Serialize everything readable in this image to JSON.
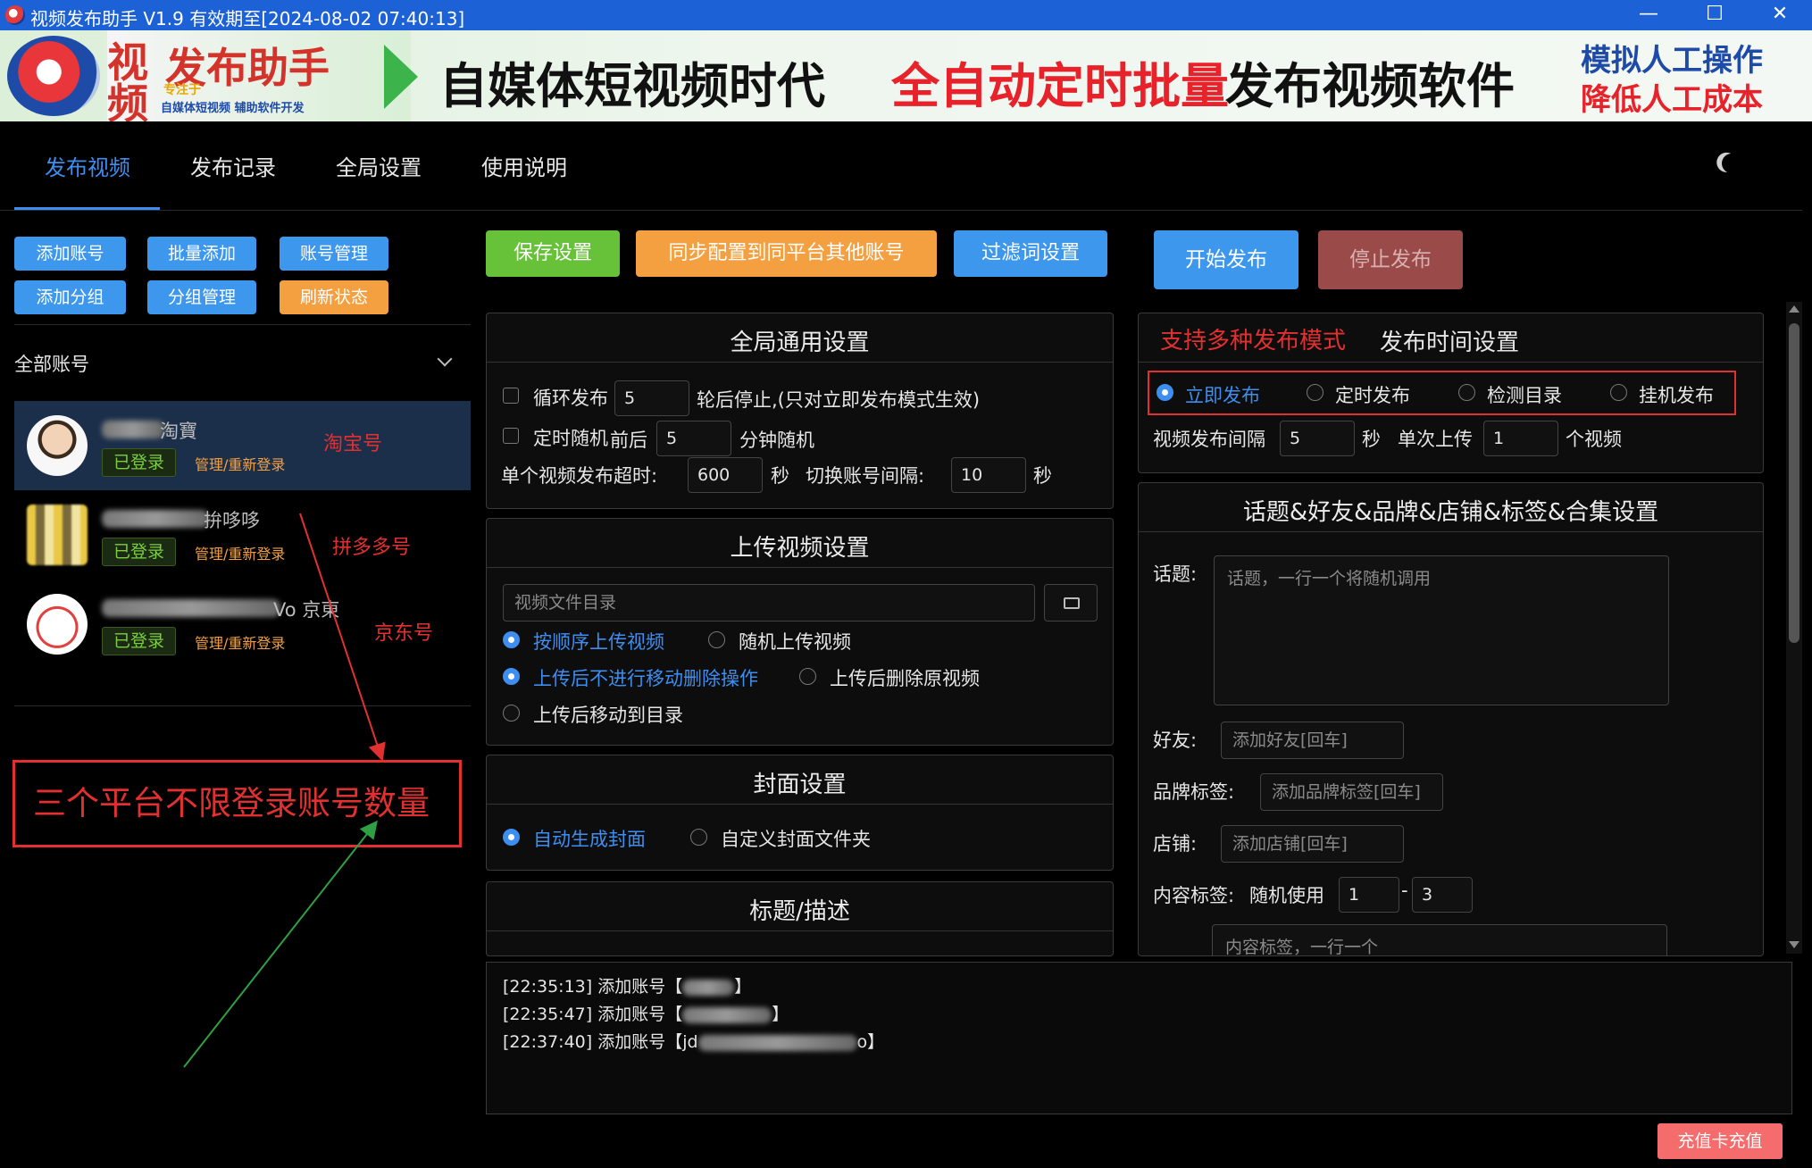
{
  "window": {
    "title": "视频发布助手 V1.9 有效期至[2024-08-02 07:40:13]",
    "minimize": "—",
    "maximize": "☐",
    "close": "✕"
  },
  "banner": {
    "logo_char_1": "视",
    "logo_char_2": "频",
    "logo_title": "发布助手",
    "logo_tag": "专注于",
    "logo_sub": "自媒体短视频 辅助软件开发",
    "slogan_black": "自媒体短视频时代",
    "slogan_red": "全自动定时批量",
    "slogan_black2": "发布视频软件",
    "right_line1": "模拟人工操作",
    "right_line2": "降低人工成本"
  },
  "tabs": [
    {
      "label": "发布视频",
      "active": true
    },
    {
      "label": "发布记录",
      "active": false
    },
    {
      "label": "全局设置",
      "active": false
    },
    {
      "label": "使用说明",
      "active": false
    }
  ],
  "left": {
    "buttons_row1": [
      "添加账号",
      "批量添加",
      "账号管理"
    ],
    "buttons_row2": [
      "添加分组",
      "分组管理",
      "刷新状态"
    ],
    "group_label": "全部账号",
    "accounts": [
      {
        "name_suffix": "淘寶",
        "status": "已登录",
        "relogin": "管理/重新登录",
        "note": "淘宝号"
      },
      {
        "name_suffix": "拚哆哆",
        "status": "已登录",
        "relogin": "管理/重新登录",
        "note": "拼多多号"
      },
      {
        "name_suffix": "Vo 京東",
        "status": "已登录",
        "relogin": "管理/重新登录",
        "note": "京东号"
      }
    ],
    "annotation": "三个平台不限登录账号数量"
  },
  "toolbar": {
    "save": "保存设置",
    "sync": "同步配置到同平台其他账号",
    "filter": "过滤词设置",
    "start": "开始发布",
    "stop": "停止发布"
  },
  "global_settings": {
    "title": "全局通用设置",
    "loop_label": "循环发布",
    "loop_value": "5",
    "loop_suffix": "轮后停止,(只对立即发布模式生效)",
    "random_label": "定时随机",
    "random_prefix": "前后",
    "random_value": "5",
    "random_suffix": "分钟随机",
    "timeout_label": "单个视频发布超时:",
    "timeout_value": "600",
    "sec1": "秒",
    "switch_label": "切换账号间隔:",
    "switch_value": "10",
    "sec2": "秒"
  },
  "upload_settings": {
    "title": "上传视频设置",
    "dir_placeholder": "视频文件目录",
    "order_seq": "按顺序上传视频",
    "order_random": "随机上传视频",
    "after_keep": "上传后不进行移动删除操作",
    "after_delete": "上传后删除原视频",
    "after_move": "上传后移动到目录"
  },
  "cover_settings": {
    "title": "封面设置",
    "auto": "自动生成封面",
    "custom": "自定义封面文件夹"
  },
  "title_desc": {
    "title": "标题/描述"
  },
  "publish_time": {
    "highlight": "支持多种发布模式",
    "title": "发布时间设置",
    "modes": [
      "立即发布",
      "定时发布",
      "检测目录",
      "挂机发布"
    ],
    "interval_label": "视频发布间隔",
    "interval_value": "5",
    "sec": "秒",
    "single_label": "单次上传",
    "single_value": "1",
    "single_suffix": "个视频"
  },
  "topic_settings": {
    "title": "话题&好友&品牌&店铺&标签&合集设置",
    "topic_label": "话题:",
    "topic_placeholder": "话题，一行一个将随机调用",
    "friend_label": "好友:",
    "friend_placeholder": "添加好友[回车]",
    "brand_label": "品牌标签:",
    "brand_placeholder": "添加品牌标签[回车]",
    "shop_label": "店铺:",
    "shop_placeholder": "添加店铺[回车]",
    "content_tag_label": "内容标签:",
    "content_tag_random": "随机使用",
    "content_tag_min": "1",
    "content_tag_dash": "-",
    "content_tag_max": "3",
    "content_tag_placeholder": "内容标签，一行一个"
  },
  "log": {
    "lines": [
      {
        "prefix": "[22:35:13] 添加账号【",
        "suffix": "】"
      },
      {
        "prefix": "[22:35:47] 添加账号【",
        "suffix": "】"
      },
      {
        "prefix": "[22:37:40] 添加账号【jd",
        "suffix": "o】"
      }
    ]
  },
  "charge": "充值卡充值",
  "colors": {
    "accent": "#3d8ef0",
    "annotation_red": "#e23030",
    "status_green": "#7ccf40",
    "orange": "#f4a040"
  }
}
